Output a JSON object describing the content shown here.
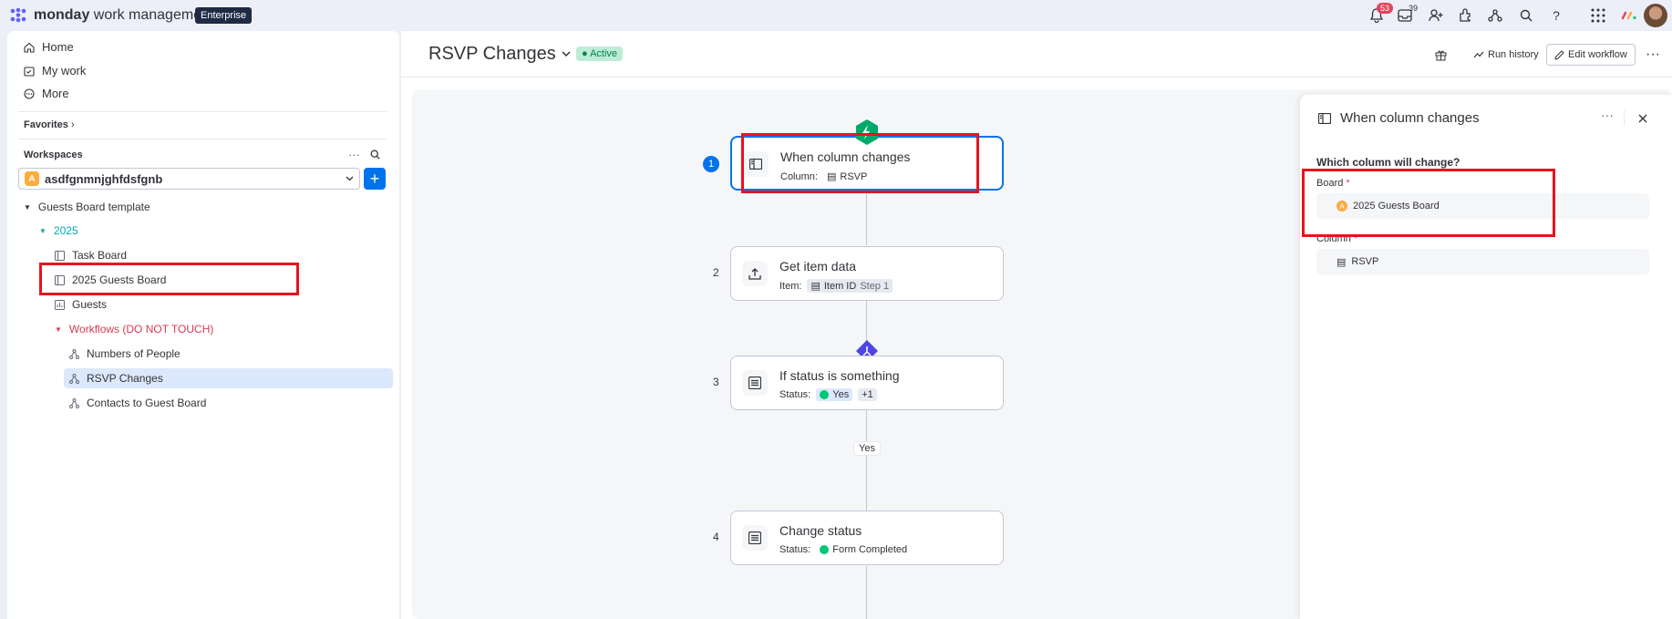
{
  "app": {
    "brand_bold": "monday",
    "brand_rest": "work management",
    "plan": "Enterprise"
  },
  "topbar": {
    "notifications_count": "53",
    "inbox_count": "39"
  },
  "sidebar": {
    "nav": [
      {
        "label": "Home"
      },
      {
        "label": "My work"
      },
      {
        "label": "More"
      }
    ],
    "favorites_label": "Favorites",
    "workspaces_label": "Workspaces",
    "workspace_name": "asdfgnmnjghfdsfgnb",
    "workspace_initial": "A",
    "tree": {
      "template": "Guests Board template",
      "folder_2025": "2025",
      "task_board": "Task Board",
      "guests_board_2025": "2025 Guests Board",
      "guests": "Guests",
      "workflows_folder": "Workflows (DO NOT TOUCH)",
      "numbers_of_people": "Numbers of People",
      "rsvp_changes": "RSVP Changes",
      "contacts_to_guest_board": "Contacts to Guest Board"
    }
  },
  "header": {
    "title": "RSVP Changes",
    "status": "Active",
    "run_history": "Run history",
    "edit_workflow": "Edit workflow"
  },
  "workflow": {
    "steps": [
      {
        "num": "1",
        "title": "When column changes",
        "sub_label": "Column:",
        "chip": "RSVP"
      },
      {
        "num": "2",
        "title": "Get item data",
        "sub_label": "Item:",
        "chip": "Item ID",
        "chip2": "Step 1"
      },
      {
        "num": "3",
        "title": "If status is something",
        "sub_label": "Status:",
        "chip": "Yes",
        "chip2": "+1"
      },
      {
        "num": "4",
        "title": "Change status",
        "sub_label": "Status:",
        "chip": "Form Completed"
      }
    ],
    "branch_label": "Yes"
  },
  "panel": {
    "title": "When column changes",
    "question": "Which column will change?",
    "board_label": "Board",
    "board_initial": "A",
    "board_value": "2025 Guests Board",
    "column_label": "Column",
    "column_value": "RSVP",
    "required_mark": "*"
  },
  "colors": {
    "accent": "#0073ea",
    "highlight": "#e8141b",
    "status_green": "#00c875",
    "active_pill": "#bdecd6"
  }
}
